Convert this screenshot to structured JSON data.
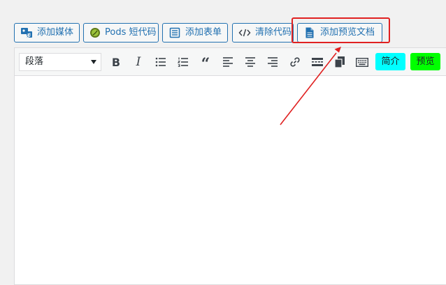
{
  "media_buttons": {
    "add_media": "添加媒体",
    "pods_shortcode": "Pods 短代码",
    "add_form": "添加表单",
    "clean_code": "清除代码",
    "add_preview_doc": "添加预览文档"
  },
  "toolbar": {
    "format_select_value": "段落",
    "bold": "B",
    "italic": "I",
    "quote": "“",
    "intro_button": "简介",
    "preview_button": "预览"
  },
  "colors": {
    "accent": "#2271b1",
    "highlight": "#e02020",
    "intro_bg": "#00ffff",
    "preview_bg": "#00ff00"
  },
  "icons": {
    "add_media": "media-icon",
    "pods_shortcode": "pods-icon",
    "add_form": "form-icon",
    "clean_code": "code-icon",
    "add_preview_doc": "document-icon"
  }
}
